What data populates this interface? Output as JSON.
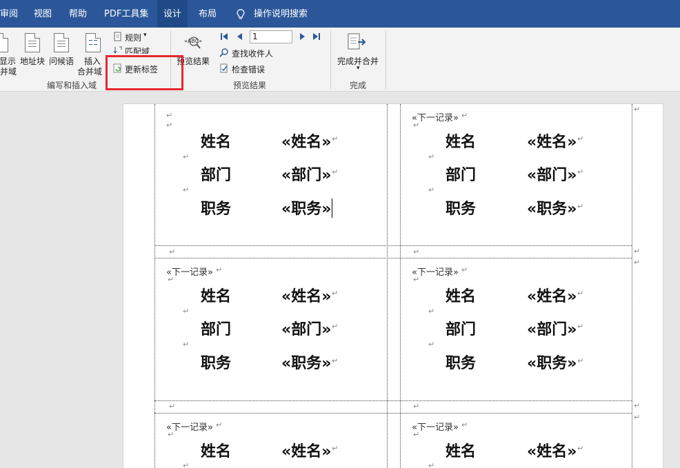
{
  "menu": {
    "tabs": [
      "审阅",
      "视图",
      "帮助",
      "PDF工具集",
      "设计",
      "布局"
    ],
    "search": "操作说明搜索"
  },
  "ribbon": {
    "btn_show_top": "显示",
    "btn_show_bottom": "并域",
    "address_block": "地址块",
    "greeting": "问候语",
    "insert_top": "插入",
    "insert_bottom": "合并域",
    "rules": "规则",
    "match_fields": "匹配域",
    "update_labels": "更新标签",
    "group_write_insert": "编写和插入域",
    "preview_results_btn": "预览结果",
    "record_value": "1",
    "find_recipient": "查找收件人",
    "check_errors": "检查错误",
    "group_preview": "预览结果",
    "finish_merge": "完成并合并",
    "group_finish": "完成"
  },
  "document": {
    "next_record": "«下一记录»",
    "labels": {
      "name": "姓名",
      "dept": "部门",
      "title": "职务"
    },
    "fields": {
      "name": "«姓名»",
      "dept": "«部门»",
      "title": "«职务»"
    },
    "return_mark": "↵"
  }
}
